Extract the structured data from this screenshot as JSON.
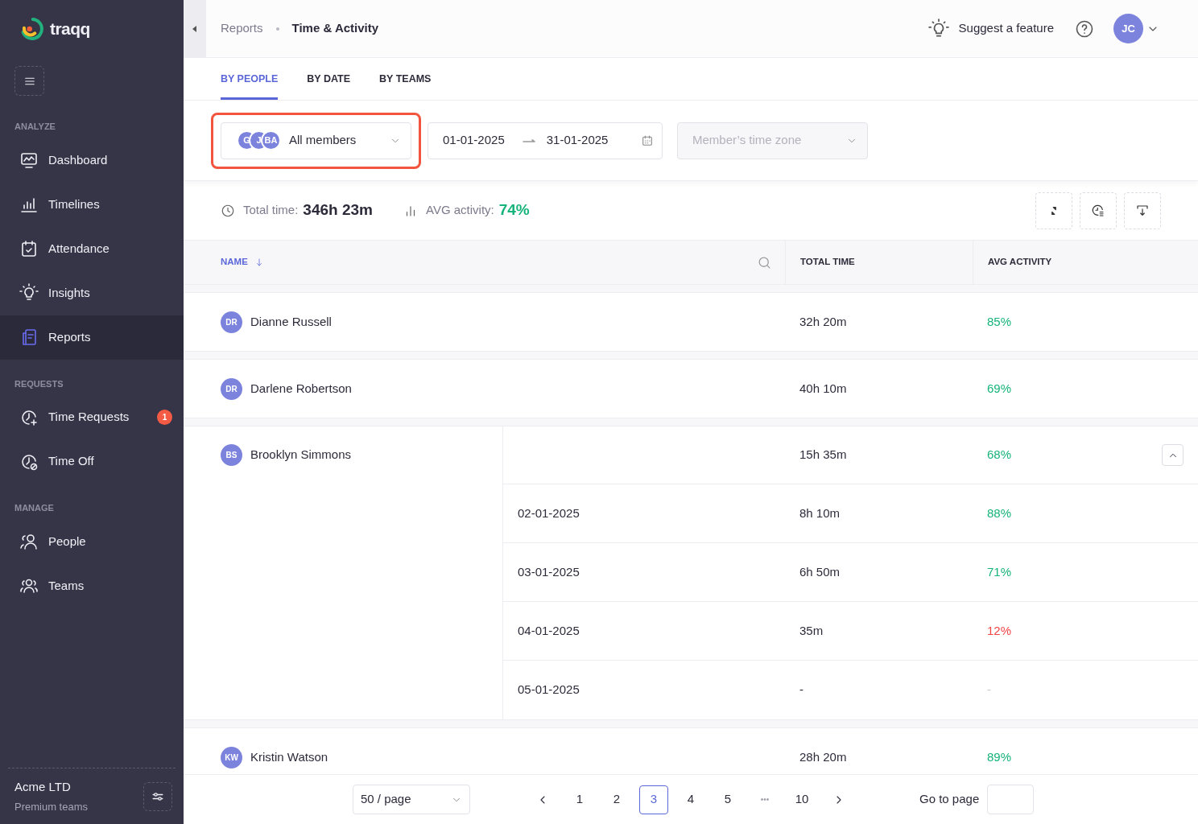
{
  "sidebar": {
    "logo": "traqq",
    "sections": [
      {
        "title": "ANALYZE",
        "items": [
          {
            "label": "Dashboard",
            "selected": false
          },
          {
            "label": "Timelines",
            "selected": false
          },
          {
            "label": "Attendance",
            "selected": false
          },
          {
            "label": "Insights",
            "selected": false
          },
          {
            "label": "Reports",
            "selected": true
          }
        ]
      },
      {
        "title": "REQUESTS",
        "items": [
          {
            "label": "Time Requests",
            "selected": false,
            "badge": "1"
          },
          {
            "label": "Time Off",
            "selected": false
          }
        ]
      },
      {
        "title": "MANAGE",
        "items": [
          {
            "label": "People",
            "selected": false
          },
          {
            "label": "Teams",
            "selected": false
          }
        ]
      }
    ],
    "footer": {
      "company": "Acme LTD",
      "plan": "Premium teams"
    }
  },
  "header": {
    "breadcrumb": [
      "Reports",
      "Time & Activity"
    ],
    "suggest": "Suggest a feature",
    "avatar": "JC"
  },
  "tabs": [
    {
      "label": "BY PEOPLE",
      "selected": true
    },
    {
      "label": "BY DATE",
      "selected": false
    },
    {
      "label": "BY TEAMS",
      "selected": false
    }
  ],
  "filters": {
    "members": {
      "avatars": [
        "G",
        "J",
        "BA"
      ],
      "label": "All members",
      "highlighted": true
    },
    "date_range": {
      "start": "01-01-2025",
      "end": "31-01-2025"
    },
    "timezone": {
      "placeholder": "Member’s time zone",
      "disabled": true
    }
  },
  "stats": {
    "total_label": "Total time:",
    "total_value": "346h 23m",
    "avg_label": "AVG activity:",
    "avg_value": "74%"
  },
  "table": {
    "columns": [
      {
        "label": "NAME",
        "sorted": true
      },
      {
        "label": "TOTAL TIME",
        "sorted": false
      },
      {
        "label": "AVG ACTIVITY",
        "sorted": false
      }
    ],
    "rows": [
      {
        "initials": "DR",
        "name": "Dianne Russell",
        "total": "32h 20m",
        "activity": "85%",
        "color": "#16b37a"
      },
      {
        "initials": "DR",
        "name": "Darlene Robertson",
        "total": "40h 10m",
        "activity": "69%",
        "color": "#16b37a"
      },
      {
        "initials": "BS",
        "name": "Brooklyn Simmons",
        "total": "15h 35m",
        "activity": "68%",
        "color": "#16b37a",
        "expanded": true,
        "children": [
          {
            "date": "02-01-2025",
            "total": "8h 10m",
            "activity": "88%",
            "color": "#16b37a"
          },
          {
            "date": "03-01-2025",
            "total": "6h 50m",
            "activity": "71%",
            "color": "#16b37a"
          },
          {
            "date": "04-01-2025",
            "total": "35m",
            "activity": "12%",
            "color": "#ef4444"
          },
          {
            "date": "05-01-2025",
            "total": "-",
            "activity": "-",
            "color": "#c8c8d0"
          }
        ]
      },
      {
        "initials": "KW",
        "name": "Kristin Watson",
        "total": "28h 20m",
        "activity": "89%",
        "color": "#16b37a"
      }
    ]
  },
  "pagination": {
    "page_size": "50 / page",
    "pages": [
      {
        "label": "1",
        "selected": false,
        "kind": "page"
      },
      {
        "label": "2",
        "selected": false,
        "kind": "page"
      },
      {
        "label": "3",
        "selected": true,
        "kind": "page"
      },
      {
        "label": "4",
        "selected": false,
        "kind": "page"
      },
      {
        "label": "5",
        "selected": false,
        "kind": "page"
      },
      {
        "label": "•••",
        "kind": "ellipsis"
      },
      {
        "label": "10",
        "selected": false,
        "kind": "page"
      }
    ],
    "go_to_label": "Go to page"
  }
}
